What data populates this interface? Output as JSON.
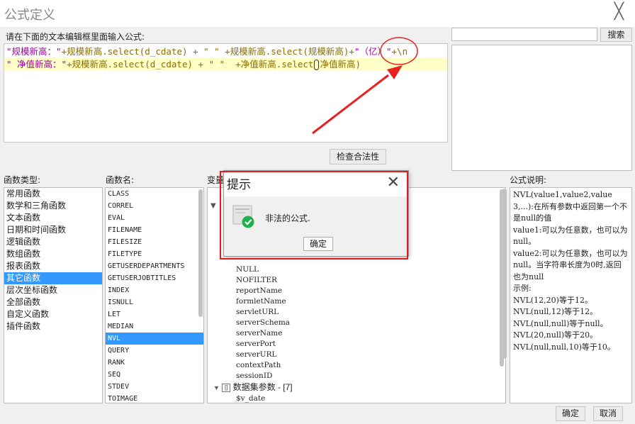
{
  "window": {
    "title": "公式定义",
    "close_glyph": "╳"
  },
  "editor": {
    "prompt": "请在下面的文本编辑框里面输入公式:",
    "line1": [
      {
        "t": "\"规模新高：\"",
        "c": "s"
      },
      {
        "t": "+规模新高.select(d_cdate) + \" \" +规模新高.select(规模新高)+",
        "c": "o"
      },
      {
        "t": "\"（亿）\"",
        "c": "s"
      },
      {
        "t": "+\\n",
        "c": "o"
      }
    ],
    "line2_a": [
      {
        "t": "\" 净值新高：\"",
        "c": "s"
      },
      {
        "t": "+规模新高.select(d_cdate) + \" \"  +净值新高.select",
        "c": "o"
      }
    ],
    "line2_b": [
      {
        "t": "净值新高)",
        "c": "o"
      }
    ],
    "check_button": "检查合法性"
  },
  "search": {
    "value": "",
    "button": "搜索"
  },
  "categories": {
    "label": "函数类型:",
    "items": [
      "常用函数",
      "数学和三角函数",
      "文本函数",
      "日期和时间函数",
      "逻辑函数",
      "数组函数",
      "报表函数",
      "其它函数",
      "层次坐标函数",
      "全部函数",
      "自定义函数",
      "插件函数"
    ],
    "selected": 7
  },
  "functions": {
    "label": "函数名:",
    "items": [
      "CLASS",
      "CORREL",
      "EVAL",
      "FILENAME",
      "FILESIZE",
      "FILETYPE",
      "GETUSERDEPARTMENTS",
      "GETUSERJOBTITLES",
      "INDEX",
      "ISNULL",
      "LET",
      "MEDIAN",
      "NVL",
      "QUERY",
      "RANK",
      "SEQ",
      "STDEV",
      "TOIMAGE"
    ],
    "selected": 12
  },
  "variables": {
    "label": "变量",
    "items": [
      "NULL",
      "NOFILTER",
      "reportName",
      "formletName",
      "servletURL",
      "serverSchema",
      "serverName",
      "serverPort",
      "serverURL",
      "contextPath",
      "sessionID"
    ],
    "group": "数据集参数 - [7]",
    "group_child": "$v_date"
  },
  "description": {
    "label": "公式说明:",
    "text": "NVL(value1,value2,value3,...):在所有参数中返回第一个不是null的值\nvalue1:可以为任意数，也可以为null。\nvalue2:可以为任意数，也可以为null。当字符串长度为0时,返回也为null\n示例:\nNVL(12,20)等于12。\nNVL(null,12)等于12。\nNVL(null,null)等于null。\nNVL(20,null)等于20。\nNVL(null,null,10)等于10。"
  },
  "footer": {
    "ok": "确定",
    "cancel": "取消"
  },
  "dialog": {
    "title": "提示",
    "message": "非法的公式.",
    "ok": "确定",
    "close_glyph": "✕"
  },
  "colors": {
    "selection": "#3399ff",
    "highlight_line": "#ffffc8",
    "annotation_red": "#e02020"
  }
}
